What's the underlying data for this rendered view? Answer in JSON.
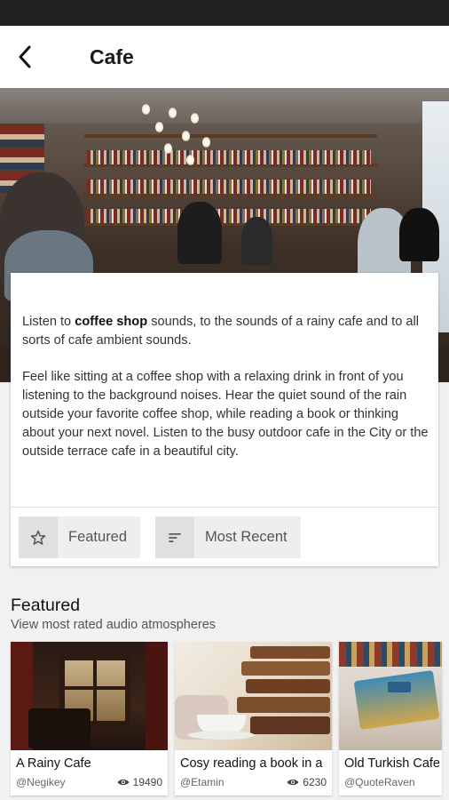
{
  "header": {
    "title": "Cafe"
  },
  "description": {
    "p1_pre": "Listen to ",
    "p1_bold": "coffee shop",
    "p1_post": " sounds, to the sounds of a rainy cafe and to all sorts of cafe ambient sounds.",
    "p2": "Feel like sitting at a coffee shop with a relaxing drink in front of you listening to the background noises. Hear the quiet sound of the rain outside your favorite coffee shop, while reading a book or thinking about your next novel. Listen to the busy outdoor cafe in the City or the outside terrace cafe in a beautiful city."
  },
  "filters": [
    {
      "label": "Featured",
      "icon": "star-outline-icon"
    },
    {
      "label": "Most Recent",
      "icon": "sort-lines-icon"
    }
  ],
  "section": {
    "title": "Featured",
    "subtitle": "View most rated audio atmospheres"
  },
  "cards": [
    {
      "title": "A Rainy Cafe",
      "author": "@Negikey",
      "views": "19490"
    },
    {
      "title": "Cosy reading a book in a",
      "author": "@Etamin",
      "views": "6230"
    },
    {
      "title": "Old Turkish Cafe",
      "author": "@QuoteRaven",
      "views": ""
    }
  ],
  "colors": {
    "status_bar": "#212121",
    "background": "#f1f1f1",
    "chip_bg": "#eeeeee"
  }
}
